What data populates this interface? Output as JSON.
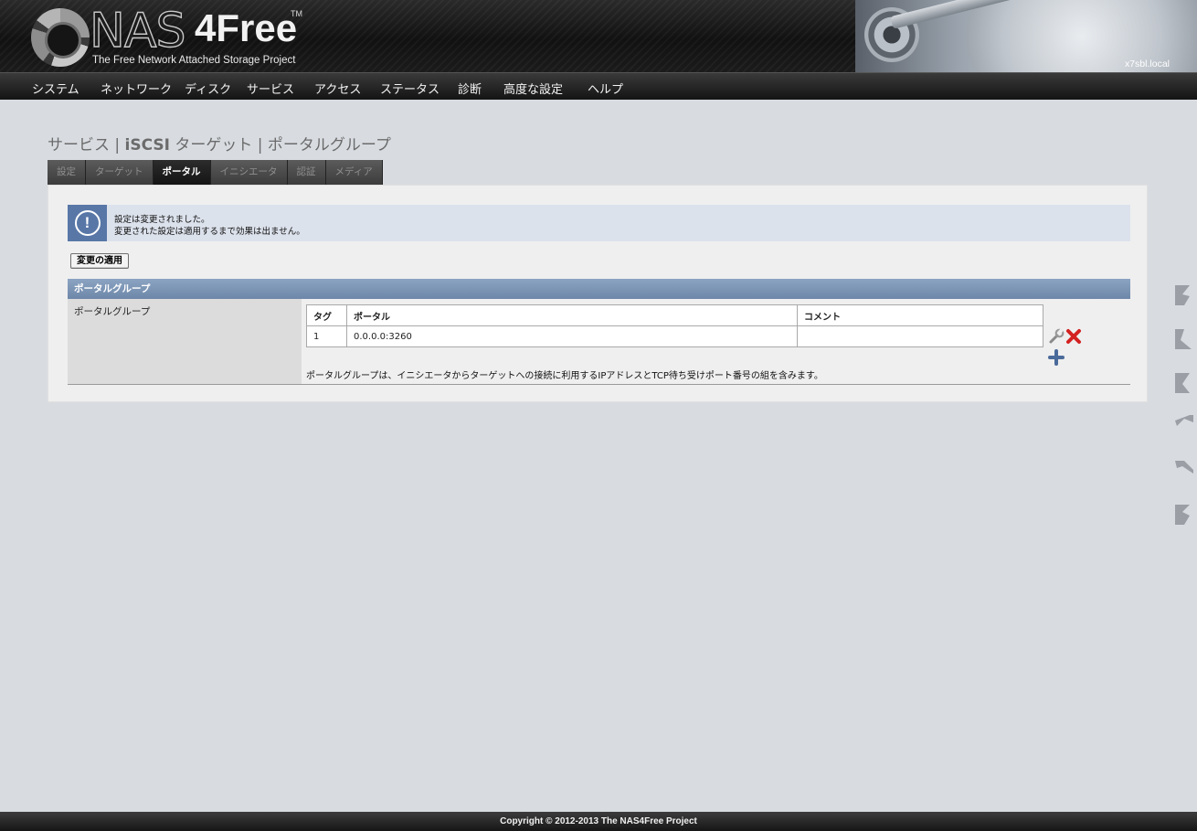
{
  "header": {
    "logo_nas": "NAS",
    "logo_4free": "4Free",
    "logo_tm": "TM",
    "tagline": "The Free Network Attached Storage Project",
    "hostname": "x7sbl.local"
  },
  "nav": {
    "items": [
      "システム",
      "ネットワーク",
      "ディスク",
      "サービス",
      "アクセス",
      "ステータス",
      "診断",
      "高度な設定",
      "ヘルプ"
    ]
  },
  "page_title": {
    "part1": "サービス | ",
    "part2": "iSCSI",
    "part3": " ターゲット | ポータルグループ"
  },
  "tabs": [
    "設定",
    "ターゲット",
    "ポータル",
    "イニシエータ",
    "認証",
    "メディア"
  ],
  "active_tab": "ポータル",
  "notice": {
    "line1": "設定は変更されました。",
    "line2": "変更された設定は適用するまで効果は出ません。",
    "icon": "exclamation-icon"
  },
  "apply_button": "変更の適用",
  "section": {
    "title": "ポータルグループ",
    "left_label": "ポータルグループ"
  },
  "table": {
    "headers": [
      "タグ",
      "ポータル",
      "コメント"
    ],
    "rows": [
      {
        "tag": "1",
        "portal": "0.0.0.0:3260",
        "comment": ""
      }
    ]
  },
  "description": "ポータルグループは、イニシエータからターゲットへの接続に利用するIPアドレスとTCP待ち受けポート番号の組を含みます。",
  "footer": "Copyright © 2012-2013 The NAS4Free Project",
  "colors": {
    "section_bar": "#7a93b5",
    "notice_bg": "#dce2ec",
    "notice_icon_bg": "#5877a7",
    "delete_icon": "#d42020",
    "add_icon": "#4a6a9a"
  }
}
